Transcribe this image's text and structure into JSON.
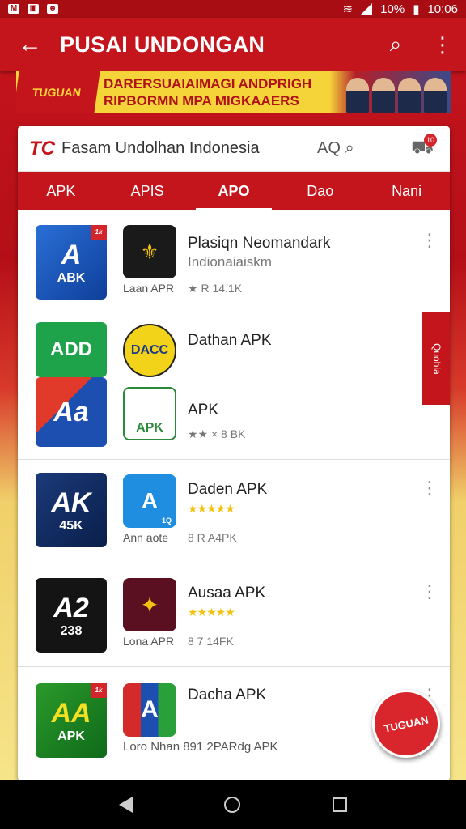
{
  "status": {
    "battery": "10%",
    "time": "10:06"
  },
  "appbar": {
    "title": "PUSAI UNDONGAN"
  },
  "banner": {
    "logo_text": "TUGUAN",
    "line1": "DARERSUAIAIMAGI ANDPRIGH",
    "line2": "RIPBORMN MPA MIGKAAERS"
  },
  "search": {
    "logo": "TC",
    "text": "Fasam Undolhan Indonesia",
    "aq_label": "AQ",
    "cart_badge": "10"
  },
  "tabs": [
    "APK",
    "APIS",
    "APO",
    "Dao",
    "Nani"
  ],
  "apps": [
    {
      "big_label": "A",
      "big_sub": "ABK",
      "big_badge": "1k",
      "name": "Plasiqn Neomandark",
      "detail": "Indionaiaiskm",
      "sub": "Laan APR",
      "meta": "★ R 14.1K"
    },
    {
      "big_label": "ADD",
      "name": "Dathan APK",
      "sm_label": "DACC"
    },
    {
      "big_label": "Aa",
      "name": "APK",
      "sm_label": "APK",
      "meta": "★★ × 8 BK"
    },
    {
      "big_label": "AK",
      "big_sub": "45K",
      "name": "Daden APK",
      "sm_label": "A",
      "sm_badge": "1Q",
      "sub": "Ann aote",
      "meta": "8 R A4PK"
    },
    {
      "big_label": "A2",
      "big_sub": "238",
      "name": "Ausaa APK",
      "sm_label": "✦",
      "sub": "Lona APR",
      "meta": "8 7 14FK"
    },
    {
      "big_label": "AA",
      "big_sub": "APK",
      "big_badge": "1k",
      "name": "Dacha APK",
      "sm_label": "A",
      "sub": "Loro Nhan 891 2PARdg APK"
    }
  ],
  "side_tab": {
    "label": "Quobia"
  },
  "fab": {
    "label": "TUGUAN"
  },
  "colors": {
    "primary": "#c4151c",
    "accent": "#f5d43a"
  },
  "icons": [
    "back-arrow-icon",
    "search-icon",
    "more-vert-icon",
    "cart-icon",
    "nav-back-icon",
    "nav-home-icon",
    "nav-recent-icon"
  ]
}
